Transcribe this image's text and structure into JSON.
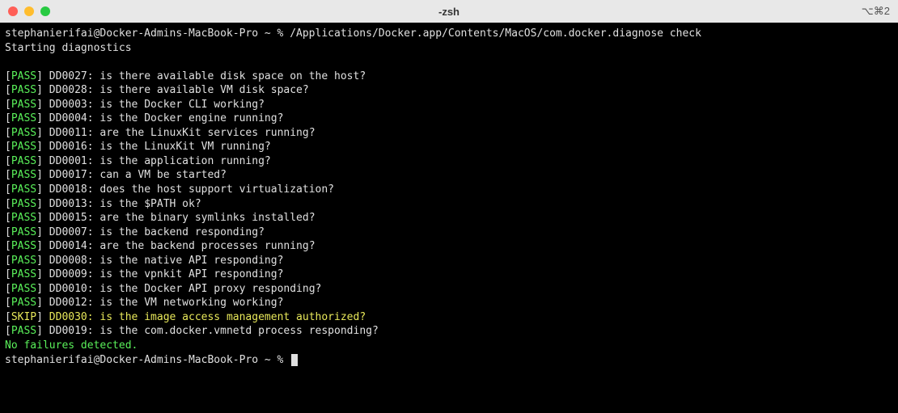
{
  "titlebar": {
    "title": "-zsh",
    "right": "⌥⌘2"
  },
  "prompt": {
    "text": "stephanierifai@Docker-Admins-MacBook-Pro ~ %",
    "command": "/Applications/Docker.app/Contents/MacOS/com.docker.diagnose check"
  },
  "starting": "Starting diagnostics",
  "checks": [
    {
      "status": "PASS",
      "code": "DD0027",
      "desc": "is there available disk space on the host?"
    },
    {
      "status": "PASS",
      "code": "DD0028",
      "desc": "is there available VM disk space?"
    },
    {
      "status": "PASS",
      "code": "DD0003",
      "desc": "is the Docker CLI working?"
    },
    {
      "status": "PASS",
      "code": "DD0004",
      "desc": "is the Docker engine running?"
    },
    {
      "status": "PASS",
      "code": "DD0011",
      "desc": "are the LinuxKit services running?"
    },
    {
      "status": "PASS",
      "code": "DD0016",
      "desc": "is the LinuxKit VM running?"
    },
    {
      "status": "PASS",
      "code": "DD0001",
      "desc": "is the application running?"
    },
    {
      "status": "PASS",
      "code": "DD0017",
      "desc": "can a VM be started?"
    },
    {
      "status": "PASS",
      "code": "DD0018",
      "desc": "does the host support virtualization?"
    },
    {
      "status": "PASS",
      "code": "DD0013",
      "desc": "is the $PATH ok?"
    },
    {
      "status": "PASS",
      "code": "DD0015",
      "desc": "are the binary symlinks installed?"
    },
    {
      "status": "PASS",
      "code": "DD0007",
      "desc": "is the backend responding?"
    },
    {
      "status": "PASS",
      "code": "DD0014",
      "desc": "are the backend processes running?"
    },
    {
      "status": "PASS",
      "code": "DD0008",
      "desc": "is the native API responding?"
    },
    {
      "status": "PASS",
      "code": "DD0009",
      "desc": "is the vpnkit API responding?"
    },
    {
      "status": "PASS",
      "code": "DD0010",
      "desc": "is the Docker API proxy responding?"
    },
    {
      "status": "PASS",
      "code": "DD0012",
      "desc": "is the VM networking working?"
    },
    {
      "status": "SKIP",
      "code": "DD0030",
      "desc": "is the image access management authorized?"
    },
    {
      "status": "PASS",
      "code": "DD0019",
      "desc": "is the com.docker.vmnetd process responding?"
    }
  ],
  "footer": "No failures detected.",
  "prompt2": "stephanierifai@Docker-Admins-MacBook-Pro ~ %"
}
